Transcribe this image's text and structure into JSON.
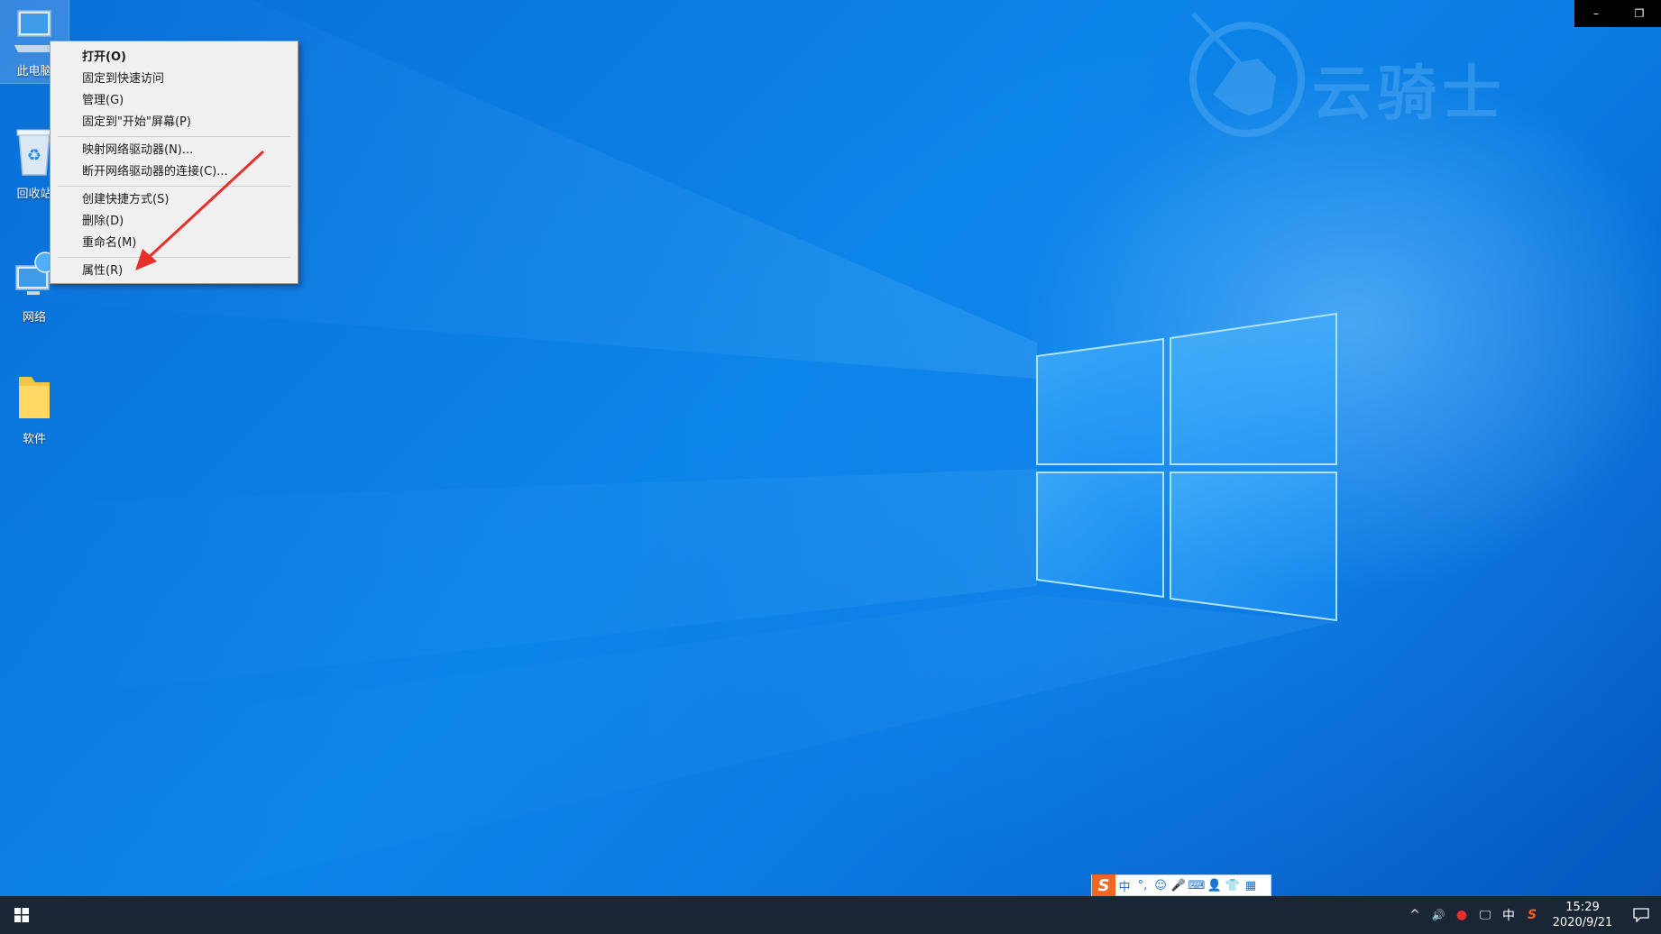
{
  "desktop": {
    "icons": [
      {
        "label": "此电脑",
        "icon": "this-pc-icon"
      },
      {
        "label": "回收站",
        "icon": "recycle-bin-icon"
      },
      {
        "label": "网络",
        "icon": "network-icon"
      },
      {
        "label": "软件",
        "icon": "folder-icon"
      }
    ],
    "watermark_text": "云骑士"
  },
  "context_menu": {
    "items": [
      {
        "label": "打开(O)",
        "bold": true
      },
      {
        "label": "固定到快速访问"
      },
      {
        "label": "管理(G)"
      },
      {
        "label": "固定到\"开始\"屏幕(P)"
      },
      {
        "label": "映射网络驱动器(N)..."
      },
      {
        "label": "断开网络驱动器的连接(C)..."
      },
      {
        "label": "创建快捷方式(S)"
      },
      {
        "label": "删除(D)"
      },
      {
        "label": "重命名(M)"
      },
      {
        "label": "属性(R)"
      }
    ]
  },
  "window_controls": {
    "minimize": "–",
    "restore": "❐"
  },
  "ime_bar": {
    "logo": "S",
    "items": [
      "中",
      "°,",
      "☺",
      "🎤",
      "⌨",
      "👤",
      "👕",
      "▦"
    ]
  },
  "taskbar": {
    "tray": {
      "chevron": "^",
      "volume": "🔊",
      "record": "●",
      "network": "🖵",
      "ime_lang": "中",
      "sogou": "S"
    },
    "time": "15:29",
    "date": "2020/9/21"
  },
  "colors": {
    "accent": "#0a78e0",
    "taskbar": "#1a2535",
    "annotation_arrow": "#e8302a"
  }
}
